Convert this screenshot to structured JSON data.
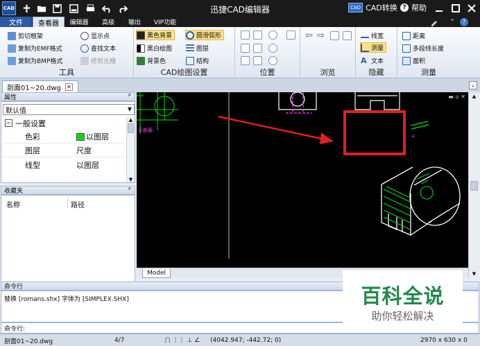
{
  "app": {
    "icon_text": "CAD",
    "title": "迅捷CAD编辑器",
    "cad_convert_label": "CAD转换",
    "help_label": "帮助"
  },
  "tabs": [
    "文件",
    "查看器",
    "编辑器",
    "高级",
    "输出",
    "VIP功能"
  ],
  "ribbon": {
    "groups": [
      {
        "name": "工具",
        "items": [
          "剪切框架",
          "复制为EMF格式",
          "复制为BMP格式",
          "显示点",
          "查找文本",
          "修剪光栅"
        ]
      },
      {
        "name": "CAD绘图设置",
        "items": [
          "黑色背景",
          "黑白绘图",
          "背景色",
          "圆滑弧形",
          "图层",
          "结构"
        ]
      },
      {
        "name": "位置",
        "items": []
      },
      {
        "name": "浏览",
        "items": []
      },
      {
        "name": "隐藏",
        "items": [
          "线宽",
          "测量",
          "文本"
        ]
      },
      {
        "name": "测量",
        "items": [
          "距离",
          "多段线长度",
          "面积"
        ]
      }
    ]
  },
  "document": {
    "tab_name": "剖面01~20.dwg"
  },
  "properties": {
    "header": "属性",
    "select_value": "默认值",
    "section": "一般设置",
    "rows": [
      {
        "key": "色彩",
        "value": "以图层",
        "color": "#00e000"
      },
      {
        "key": "图层",
        "value": "尺度"
      },
      {
        "key": "线型",
        "value": "以图层"
      }
    ]
  },
  "favorites": {
    "header": "收藏夹",
    "columns": [
      "名称",
      "路径"
    ]
  },
  "canvas": {
    "model_tab": "Model",
    "side_label": "示剖面"
  },
  "command": {
    "header": "命令行",
    "log": "替换 [romans.shx] 字体为 [SIMPLEX.SHX]",
    "prompt": "命令行:"
  },
  "status": {
    "file": "剖面01~20.dwg",
    "page": "4/7",
    "coords": "(4042.947; -442.72; 0)",
    "size": "2970 x 630 x 0"
  },
  "watermark": {
    "line1": "百科全说",
    "line2": "助你轻松解决"
  },
  "colors": {
    "title_bg": "#1a1a1a",
    "accent": "#2a5aa8",
    "highlight": "#fde28a",
    "annotation": "#e02020"
  }
}
